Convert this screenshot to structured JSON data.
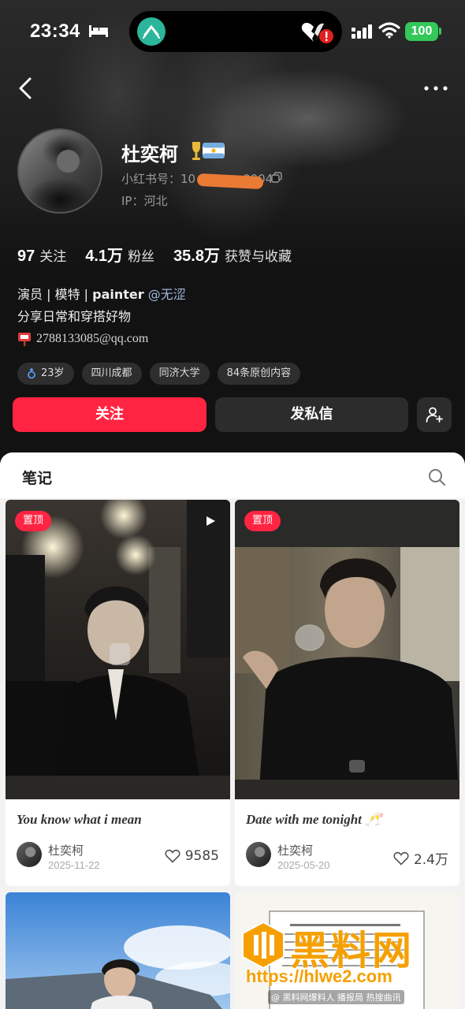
{
  "status_bar": {
    "time": "23:34",
    "battery": "100",
    "icons": [
      "bed-icon",
      "island-app-icon",
      "broken-heart-icon",
      "signal-icon",
      "wifi-icon"
    ]
  },
  "nav": {
    "back_icon": "chevron-left-icon",
    "more_icon": "more-dots-icon"
  },
  "profile": {
    "nickname": "杜奕柯",
    "red_id_label": "小红书号：10",
    "red_id_tail": "0004",
    "ip_label": "IP：河北",
    "stats": [
      {
        "num": "97",
        "label": "关注"
      },
      {
        "num": "4.1万",
        "label": "粉丝"
      },
      {
        "num": "35.8万",
        "label": "获赞与收藏"
      }
    ],
    "bio": {
      "line1_a": "演员 | 模特 | ",
      "line1_b": "painter",
      "line1_mention": " @无涩",
      "line2": "分享日常和穿搭好物",
      "email": "2788133085@qq.com"
    },
    "tags": [
      "23岁",
      "四川成都",
      "同济大学",
      "84条原创内容"
    ],
    "buttons": {
      "follow": "关注",
      "dm": "发私信"
    }
  },
  "feed": {
    "tab": "笔记",
    "cards": [
      {
        "pin": "置顶",
        "title": "You know what i mean",
        "author": "杜奕柯",
        "date": "2025-11-22",
        "likes": "9585"
      },
      {
        "pin": "置顶",
        "title": "Date with me tonight 🥂",
        "author": "杜奕柯",
        "date": "2025-05-20",
        "likes": "2.4万"
      }
    ]
  },
  "watermark": {
    "brand": "黑料网",
    "url": "https://hlwe2.com",
    "caption": "@ 黑料网爆料人 播报局 热搜曲讯"
  },
  "colors": {
    "accent": "#ff2442",
    "header_bg": "#121212",
    "feed_bg": "#f2f2f2",
    "watermark": "#f5a000"
  }
}
